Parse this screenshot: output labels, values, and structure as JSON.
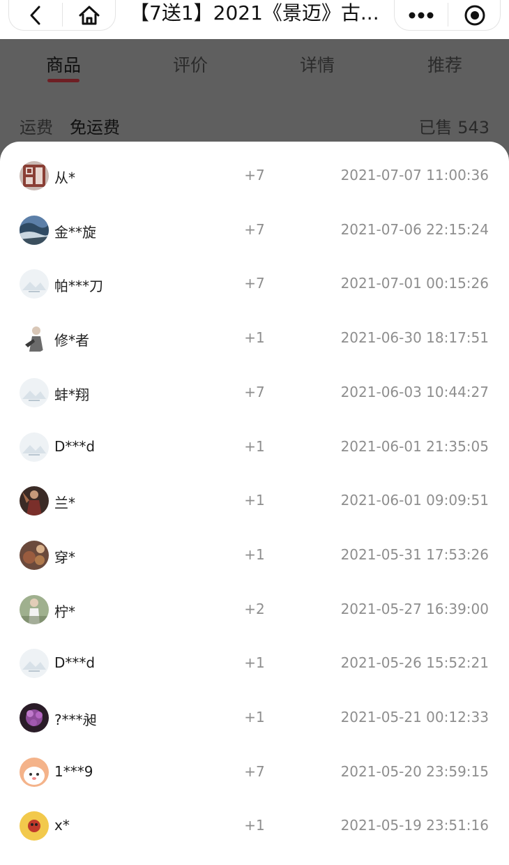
{
  "topbar": {
    "title": "【7送1】2021《景迈》古...",
    "back_icon": "chevron-left-icon",
    "home_icon": "home-icon",
    "more_icon": "more-dots-icon",
    "target_icon": "target-icon"
  },
  "tabs": [
    {
      "label": "商品",
      "active": true
    },
    {
      "label": "评价",
      "active": false
    },
    {
      "label": "详情",
      "active": false
    },
    {
      "label": "推荐",
      "active": false
    }
  ],
  "shipping": {
    "label": "运费",
    "value": "免运费"
  },
  "sold": "已售 543",
  "purchases": [
    {
      "name": "从*",
      "qty": "+7",
      "time": "2021-07-07 11:00:36",
      "avatar": "seal"
    },
    {
      "name": "金**旋",
      "qty": "+7",
      "time": "2021-07-06 22:15:24",
      "avatar": "river"
    },
    {
      "name": "帕***刀",
      "qty": "+7",
      "time": "2021-07-01 00:15:26",
      "avatar": "default"
    },
    {
      "name": "修*者",
      "qty": "+1",
      "time": "2021-06-30 18:17:51",
      "avatar": "figure"
    },
    {
      "name": "蚌*翔",
      "qty": "+7",
      "time": "2021-06-03 10:44:27",
      "avatar": "default"
    },
    {
      "name": "D***d",
      "qty": "+1",
      "time": "2021-06-01 21:35:05",
      "avatar": "default"
    },
    {
      "name": "兰*",
      "qty": "+1",
      "time": "2021-06-01 09:09:51",
      "avatar": "dark-figure"
    },
    {
      "name": "穿*",
      "qty": "+1",
      "time": "2021-05-31 17:53:26",
      "avatar": "teapots"
    },
    {
      "name": "柠*",
      "qty": "+2",
      "time": "2021-05-27 16:39:00",
      "avatar": "person"
    },
    {
      "name": "D***d",
      "qty": "+1",
      "time": "2021-05-26 15:52:21",
      "avatar": "default"
    },
    {
      "name": "?***昶",
      "qty": "+1",
      "time": "2021-05-21 00:12:33",
      "avatar": "flower"
    },
    {
      "name": "1***9",
      "qty": "+7",
      "time": "2021-05-20 23:59:15",
      "avatar": "cartoon"
    },
    {
      "name": "x*",
      "qty": "+1",
      "time": "2021-05-19 23:51:16",
      "avatar": "yellow"
    }
  ],
  "colors": {
    "tab_underline": "#6e1f24",
    "overlay": "#5f5f5f",
    "muted_text": "#8e8e8e"
  }
}
